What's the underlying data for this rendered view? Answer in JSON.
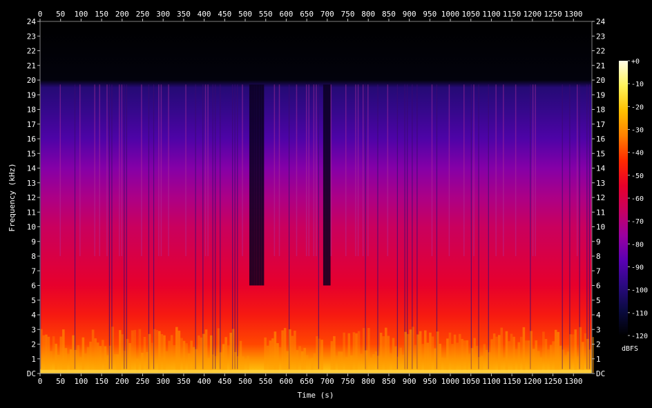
{
  "chart_data": {
    "type": "heatmap",
    "title": "",
    "xlabel": "Time (s)",
    "ylabel": "Frequency (kHz)",
    "x_unit": "s",
    "y_unit": "kHz",
    "xlim": [
      0,
      1345
    ],
    "ylim": [
      0,
      24
    ],
    "x_ticks": [
      0,
      50,
      100,
      150,
      200,
      250,
      300,
      350,
      400,
      450,
      500,
      550,
      600,
      650,
      700,
      750,
      800,
      850,
      900,
      950,
      1000,
      1050,
      1100,
      1150,
      1200,
      1250,
      1300
    ],
    "y_ticks": [
      "DC",
      "1",
      "2",
      "3",
      "4",
      "5",
      "6",
      "7",
      "8",
      "9",
      "10",
      "11",
      "12",
      "13",
      "14",
      "15",
      "16",
      "17",
      "18",
      "19",
      "20",
      "21",
      "22",
      "23",
      "24"
    ],
    "colorbar": {
      "label": "dBFS",
      "range": [
        -120,
        0
      ],
      "ticks": [
        "+0",
        "-10",
        "-20",
        "-30",
        "-40",
        "-50",
        "-60",
        "-70",
        "-80",
        "-90",
        "-100",
        "-110",
        "-120"
      ],
      "colors": [
        "#fffbe6",
        "#fff35a",
        "#ffc000",
        "#ff8000",
        "#ff2a00",
        "#e8002a",
        "#c80060",
        "#9a00a0",
        "#5a00b4",
        "#2a0a80",
        "#0a0a40",
        "#000000"
      ]
    },
    "spectrum_profile": {
      "description_levels_dbfs_by_khz": [
        [
          0,
          -20
        ],
        [
          1,
          -30
        ],
        [
          2,
          -40
        ],
        [
          4,
          -48
        ],
        [
          6,
          -55
        ],
        [
          8,
          -60
        ],
        [
          10,
          -65
        ],
        [
          12,
          -72
        ],
        [
          14,
          -80
        ],
        [
          16,
          -90
        ],
        [
          18,
          -96
        ],
        [
          19.5,
          -100
        ],
        [
          20,
          -118
        ],
        [
          24,
          -120
        ]
      ]
    },
    "quiet_segments_s": [
      [
        510,
        545
      ],
      [
        690,
        705
      ]
    ],
    "cutoff_khz": 19.7
  }
}
